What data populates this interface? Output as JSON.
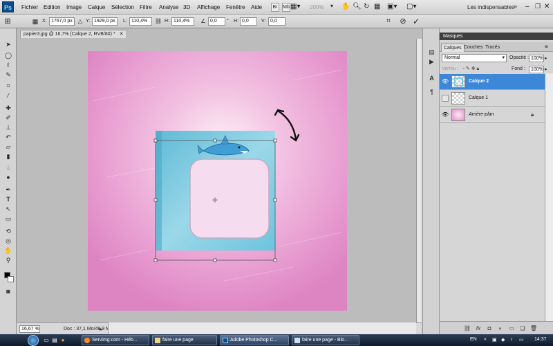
{
  "colors": {
    "selected_layer": "#3d86d8",
    "canvas_pink": "#e89bd0",
    "frame_blue": "#86cde0"
  },
  "menubar": {
    "logo": "Ps",
    "items": [
      "Fichier",
      "Edition",
      "Image",
      "Calque",
      "Sélection",
      "Filtre",
      "Analyse",
      "3D",
      "Affichage",
      "Fenêtre",
      "Aide"
    ],
    "zoom_level": "200%",
    "workspace": "Les indispensables"
  },
  "options": {
    "x_label": "X:",
    "x_value": "1767,0 px",
    "y_label": "Y:",
    "y_value": "1929,0 px",
    "w_label": "L:",
    "w_value": "110,4%",
    "h_label": "H:",
    "h_value": "110,4%",
    "angle_value": "0,0",
    "angle_unit": "°",
    "hskew_label": "H:",
    "hskew_value": "0,0",
    "vskew_label": "V:",
    "vskew_value": "0,0"
  },
  "toolbox": {
    "icons": [
      "move-icon",
      "marquee-icon",
      "lasso-icon",
      "quick-select-icon",
      "crop-icon",
      "eyedropper-icon",
      "healing-icon",
      "brush-icon",
      "stamp-icon",
      "history-brush-icon",
      "eraser-icon",
      "gradient-icon",
      "blur-icon",
      "dodge-icon",
      "pen-icon",
      "type-icon",
      "path-select-icon",
      "shape-icon",
      "3d-rotate-icon",
      "3d-orbit-icon",
      "hand-icon",
      "zoom-icon"
    ]
  },
  "document": {
    "tab_title": "papier3.jpg @ 16,7% (Calque 2, RVB/8#) *",
    "zoom": "16,67 %",
    "info": "Doc : 37,1 Mo/48,9 Mo"
  },
  "layers_panel": {
    "title": "Masques",
    "tabs": [
      "Calques",
      "Couches",
      "Tracés"
    ],
    "blend_mode": "Normal",
    "opacity_label": "Opacité :",
    "opacity": "100%",
    "lock_label": "Verrou :",
    "fill_label": "Fond :",
    "fill": "100%",
    "layers": [
      {
        "name": "Calque 2",
        "selected": true
      },
      {
        "name": "Calque 1",
        "selected": false
      },
      {
        "name": "Arrière-plan",
        "selected": false
      }
    ]
  },
  "taskbar": {
    "buttons": [
      "Servimg.com - Héb...",
      "faire une page",
      "Adobe Photoshop C...",
      "faire une page - Blo..."
    ],
    "lang": "EN",
    "clock": "14:37"
  }
}
